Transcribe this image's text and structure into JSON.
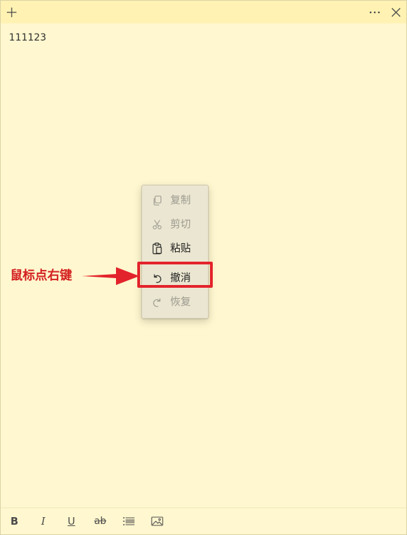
{
  "titlebar": {
    "add_icon": "plus-icon",
    "more_icon": "more-icon",
    "close_icon": "close-icon"
  },
  "note": {
    "text": "111123"
  },
  "context_menu": {
    "items": [
      {
        "label": "复制",
        "icon": "copy-icon",
        "enabled": false
      },
      {
        "label": "剪切",
        "icon": "cut-icon",
        "enabled": false
      },
      {
        "label": "粘贴",
        "icon": "paste-icon",
        "enabled": true
      },
      {
        "label": "撤消",
        "icon": "undo-icon",
        "enabled": true
      },
      {
        "label": "恢复",
        "icon": "redo-icon",
        "enabled": false
      }
    ]
  },
  "annotation": {
    "text": "鼠标点右键",
    "color": "#e3232b"
  },
  "toolbar": {
    "bold_label": "B",
    "italic_label": "I",
    "underline_label": "U",
    "strike_label": "ab",
    "list_icon": "list-icon",
    "image_icon": "image-icon"
  },
  "colors": {
    "background": "#fff7cf",
    "titlebar": "#fff2b3",
    "menu": "#ebe6d1"
  }
}
